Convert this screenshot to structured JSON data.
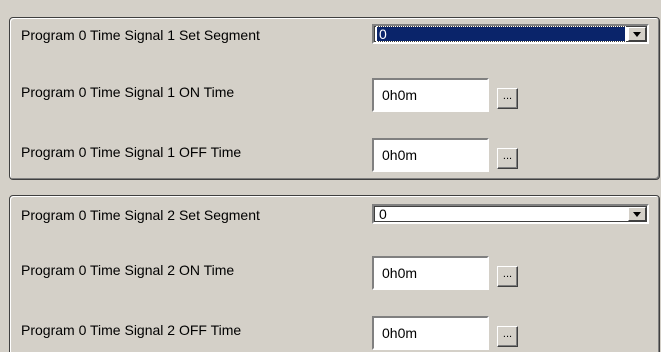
{
  "groups": [
    {
      "segment": {
        "label": "Program 0 Time Signal 1 Set Segment",
        "value": "0",
        "selected": true
      },
      "on_time": {
        "label": "Program 0 Time Signal 1 ON Time",
        "value": "0h0m",
        "button": "..."
      },
      "off_time": {
        "label": "Program 0 Time Signal 1 OFF Time",
        "value": "0h0m",
        "button": "..."
      }
    },
    {
      "segment": {
        "label": "Program 0 Time Signal 2 Set Segment",
        "value": "0",
        "selected": false
      },
      "on_time": {
        "label": "Program 0 Time Signal 2 ON Time",
        "value": "0h0m",
        "button": "..."
      },
      "off_time": {
        "label": "Program 0 Time Signal 2 OFF Time",
        "value": "0h0m",
        "button": "..."
      }
    }
  ]
}
